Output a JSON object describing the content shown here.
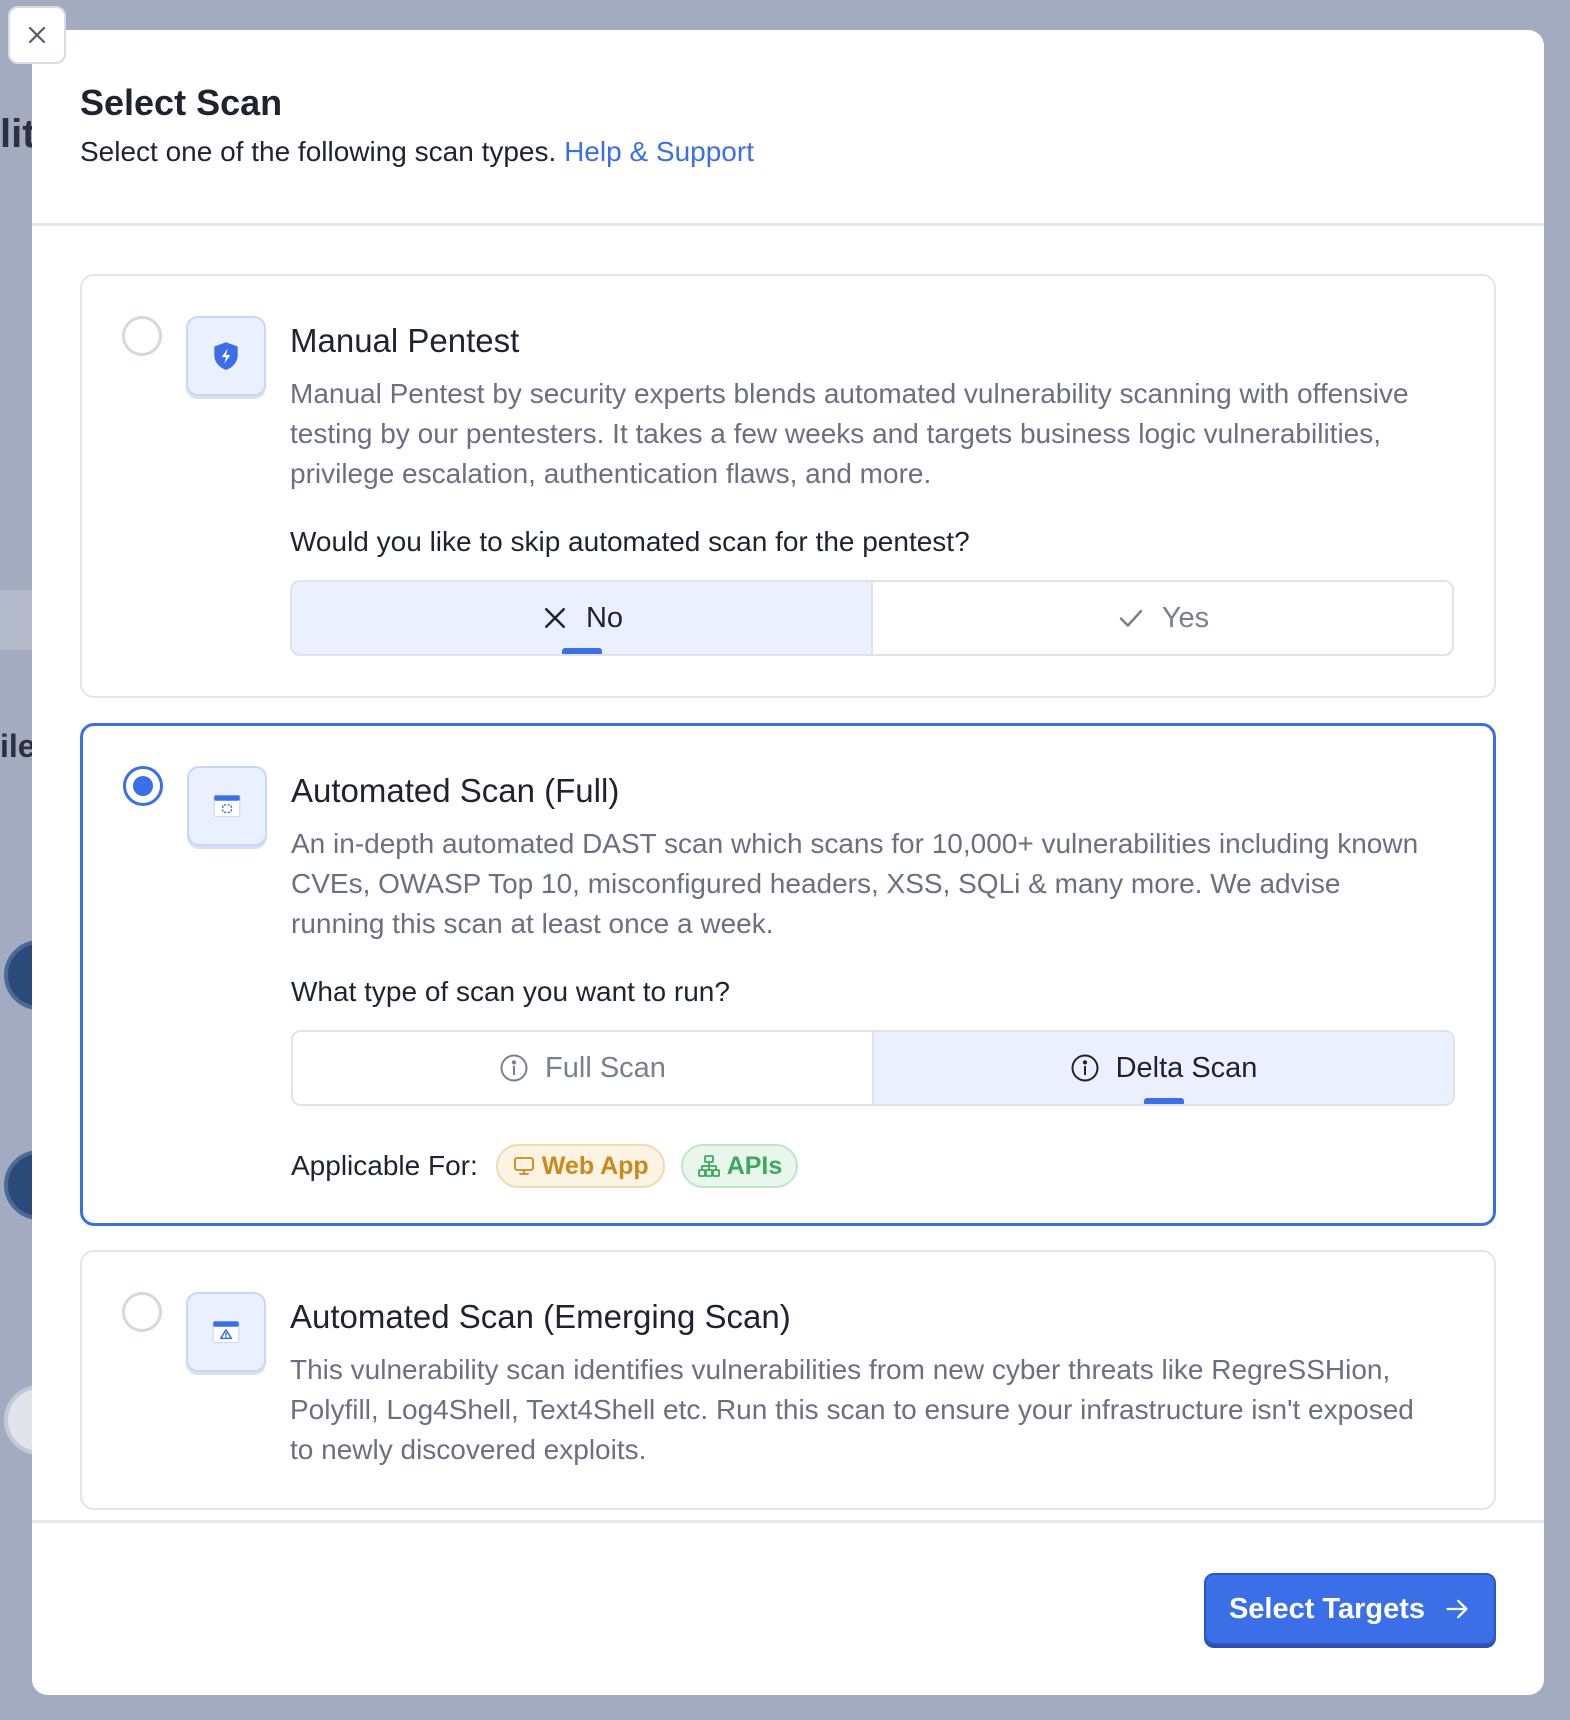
{
  "modal": {
    "title": "Select Scan",
    "subtitle": "Select one of the following scan types.",
    "help_link": "Help & Support"
  },
  "options": [
    {
      "title": "Manual Pentest",
      "icon": "shield-bolt-icon",
      "selected": false,
      "description": "Manual Pentest by security experts blends automated vulnerability scanning with offensive testing by our pentesters. It takes a few weeks and targets business logic vulnerabilities, privilege escalation, authentication flaws, and more.",
      "question": "Would you like to skip automated scan for the pentest?",
      "choices": [
        {
          "label": "No",
          "icon": "x-icon",
          "active": true
        },
        {
          "label": "Yes",
          "icon": "check-icon",
          "active": false
        }
      ]
    },
    {
      "title": "Automated Scan (Full)",
      "icon": "browser-scan-icon",
      "selected": true,
      "description": "An in-depth automated DAST scan which scans for 10,000+ vulnerabilities including known CVEs, OWASP Top 10, misconfigured headers, XSS, SQLi & many more. We advise running this scan at least once a week.",
      "question": "What type of scan you want to run?",
      "choices": [
        {
          "label": "Full Scan",
          "icon": "info-icon",
          "active": false
        },
        {
          "label": "Delta Scan",
          "icon": "info-icon",
          "active": true
        }
      ],
      "applicable_label": "Applicable For:",
      "applicable_tags": [
        {
          "label": "Web App",
          "icon": "monitor-icon",
          "color": "#c98a1d"
        },
        {
          "label": "APIs",
          "icon": "api-tree-icon",
          "color": "#3ea85d"
        }
      ]
    },
    {
      "title": "Automated Scan (Emerging Scan)",
      "icon": "browser-warning-icon",
      "selected": false,
      "description": "This vulnerability scan identifies vulnerabilities from new cyber threats like RegreSSHion, Polyfill, Log4Shell, Text4Shell etc. Run this scan to ensure your infrastructure isn't exposed to newly discovered exploits."
    }
  ],
  "footer": {
    "primary_button": "Select Targets"
  },
  "background": {
    "partial_text_1": "lit",
    "partial_text_2": "ile"
  },
  "colors": {
    "accent": "#3b6fe8",
    "web_app_tag": "#c98a1d",
    "api_tag": "#3ea85d"
  }
}
